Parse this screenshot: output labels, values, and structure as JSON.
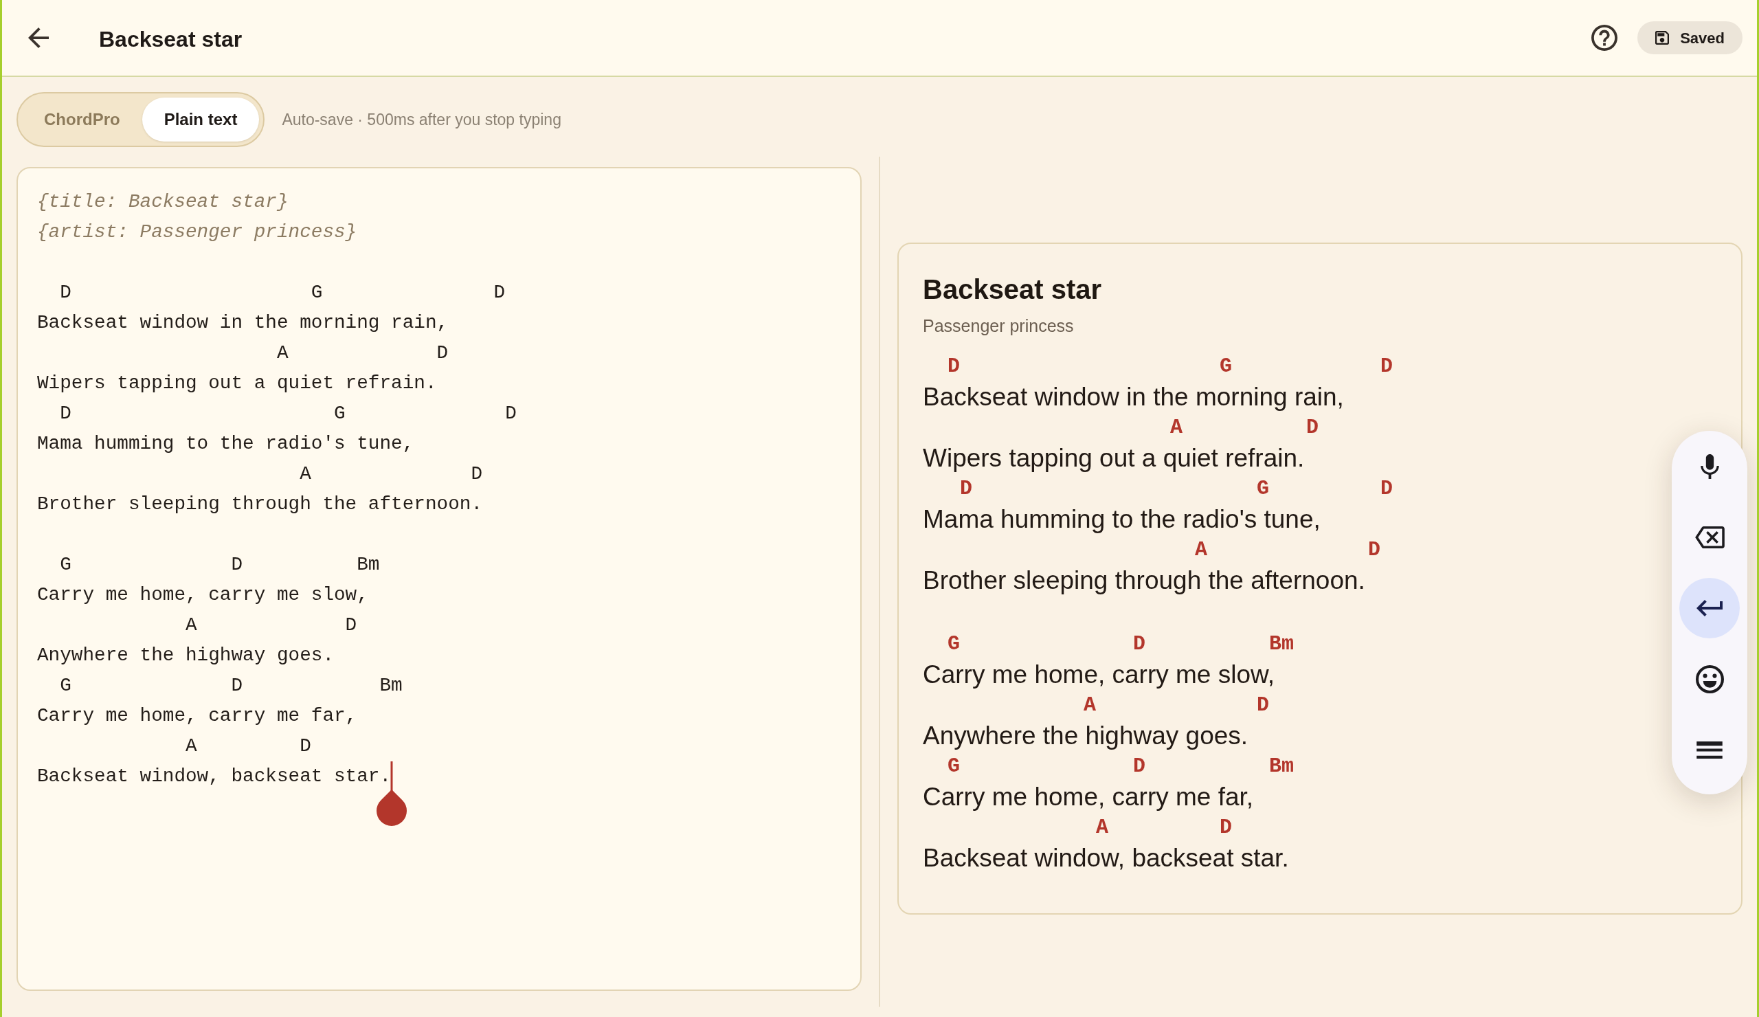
{
  "header": {
    "title": "Backseat star",
    "save_status": "Saved"
  },
  "mode_tabs": [
    {
      "label": "ChordPro",
      "selected": false
    },
    {
      "label": "Plain text",
      "selected": true
    }
  ],
  "autosave_hint": "Auto-save · 500ms after you stop typing",
  "editor": {
    "focused": true,
    "lines": [
      {
        "kind": "directive",
        "text": "{title: Backseat star}"
      },
      {
        "kind": "directive",
        "text": "{artist: Passenger princess}"
      },
      {
        "kind": "blank"
      },
      {
        "kind": "chords",
        "text": "  D                     G               D"
      },
      {
        "kind": "lyric",
        "text": "Backseat window in the morning rain,"
      },
      {
        "kind": "chords",
        "text": "                     A             D"
      },
      {
        "kind": "lyric",
        "text": "Wipers tapping out a quiet refrain."
      },
      {
        "kind": "chords",
        "text": "  D                       G              D"
      },
      {
        "kind": "lyric",
        "text": "Mama humming to the radio's tune,"
      },
      {
        "kind": "chords",
        "text": "                       A              D"
      },
      {
        "kind": "lyric",
        "text": "Brother sleeping through the afternoon."
      },
      {
        "kind": "blank"
      },
      {
        "kind": "chords",
        "text": "  G              D          Bm"
      },
      {
        "kind": "lyric",
        "text": "Carry me home, carry me slow,"
      },
      {
        "kind": "chords",
        "text": "             A             D"
      },
      {
        "kind": "lyric",
        "text": "Anywhere the highway goes."
      },
      {
        "kind": "chords",
        "text": "  G              D            Bm"
      },
      {
        "kind": "lyric",
        "text": "Carry me home, carry me far,"
      },
      {
        "kind": "chords",
        "text": "             A         D"
      },
      {
        "kind": "lyric",
        "text": "Backseat window, backseat star."
      }
    ]
  },
  "preview": {
    "title": "Backseat star",
    "artist": "Passenger princess",
    "stanzas": [
      {
        "lines": [
          {
            "chords": "  D                     G            D",
            "lyric": "Backseat window in the morning rain,"
          },
          {
            "chords": "                    A          D",
            "lyric": "Wipers tapping out a quiet refrain."
          },
          {
            "chords": "   D                       G         D",
            "lyric": "Mama humming to the radio's tune,"
          },
          {
            "chords": "                      A             D",
            "lyric": "Brother sleeping through the afternoon."
          }
        ]
      },
      {
        "lines": [
          {
            "chords": "  G              D          Bm",
            "lyric": "Carry me home, carry me slow,"
          },
          {
            "chords": "             A             D",
            "lyric": "Anywhere the highway goes."
          },
          {
            "chords": "  G              D          Bm",
            "lyric": "Carry me home, carry me far,"
          },
          {
            "chords": "              A         D",
            "lyric": "Backseat window, backseat star."
          }
        ]
      }
    ]
  },
  "keyboard_toolbar": {
    "buttons": [
      {
        "kind": "mic",
        "selected": false
      },
      {
        "kind": "backspace",
        "selected": false
      },
      {
        "kind": "enter",
        "selected": true
      },
      {
        "kind": "emoji",
        "selected": false
      },
      {
        "kind": "menu",
        "selected": false
      }
    ]
  }
}
